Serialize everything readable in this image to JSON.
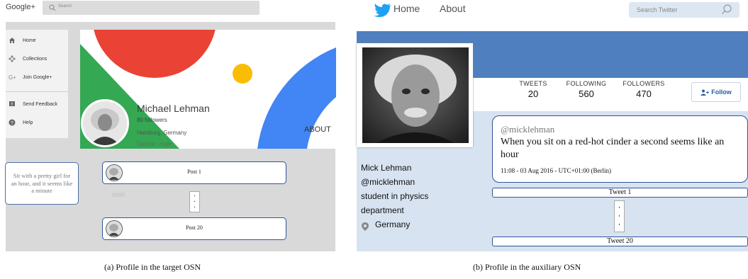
{
  "google_plus": {
    "logo": "Google+",
    "search_placeholder": "Search",
    "sidebar": [
      {
        "label": "Home",
        "icon": "home-icon"
      },
      {
        "label": "Collections",
        "icon": "collections-icon"
      },
      {
        "label": "Join Google+",
        "icon": "google-plus-icon"
      },
      {
        "label": "Send Feedback",
        "icon": "feedback-icon"
      },
      {
        "label": "Help",
        "icon": "help-icon"
      }
    ],
    "profile": {
      "name": "Michael Lehman",
      "followers": "80 followers",
      "location": "Hamburg, Germany",
      "gender": "Gender: male",
      "about_tab": "ABOUT"
    },
    "quote": "Sit with a pretty girl for an hour, and it seems like a minute",
    "posts": [
      {
        "label": "Post 1"
      },
      {
        "label": "Post 20"
      }
    ],
    "ellipsis": "·\n·\n·",
    "colors": {
      "red": "#ea4335",
      "green": "#34a853",
      "blue": "#4285f4",
      "yellow": "#fbbc05",
      "post_border": "#2f5597"
    }
  },
  "twitter": {
    "nav": {
      "home": "Home",
      "about": "About"
    },
    "search_placeholder": "Search Twitter",
    "stats": [
      {
        "label": "TWEETS",
        "value": "20"
      },
      {
        "label": "FOLLOWING",
        "value": "560"
      },
      {
        "label": "FOLLOWERS",
        "value": "470"
      }
    ],
    "follow_label": "Follow",
    "profile": {
      "name": "Mick Lehman",
      "handle": "@micklehman",
      "bio_line1": "student in physics",
      "bio_line2": "department",
      "location": "Germany"
    },
    "tweet": {
      "handle": "@micklehman",
      "text": "When you sit on a red-hot cinder a second seems like an hour",
      "timestamp": "11:08 - 03 Aug 2016 - UTC+01:00 (Berlin)"
    },
    "tweet_list": [
      {
        "label": "Tweet 1"
      },
      {
        "label": "Tweet 20"
      }
    ],
    "colors": {
      "brand": "#1da1f2",
      "banner": "#4f7fbf",
      "background": "#d7e3f1"
    }
  },
  "captions": {
    "left": "(a)  Profile in the target OSN",
    "right": "(b)  Profile in the auxiliary OSN"
  }
}
